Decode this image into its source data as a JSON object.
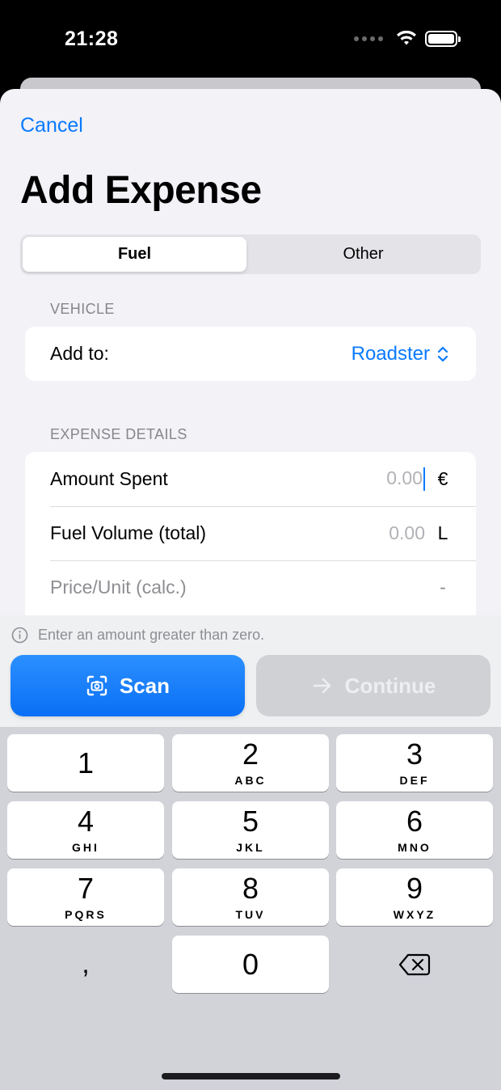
{
  "status_bar": {
    "time": "21:28"
  },
  "nav": {
    "cancel_label": "Cancel",
    "title": "Add Expense"
  },
  "segments": {
    "fuel": "Fuel",
    "other": "Other",
    "selected": "Fuel"
  },
  "vehicle_section": {
    "header": "VEHICLE",
    "add_to_label": "Add to:",
    "vehicle_value": "Roadster"
  },
  "details_section": {
    "header": "EXPENSE DETAILS",
    "amount_label": "Amount Spent",
    "amount_placeholder": "0.00",
    "amount_unit": "€",
    "volume_label": "Fuel Volume (total)",
    "volume_placeholder": "0.00",
    "volume_unit": "L",
    "price_label": "Price/Unit (calc.)",
    "price_value": "-"
  },
  "accessory": {
    "hint": "Enter an amount greater than zero.",
    "scan_label": "Scan",
    "continue_label": "Continue",
    "continue_enabled": false
  },
  "keyboard": {
    "keys": [
      {
        "num": "1",
        "letters": ""
      },
      {
        "num": "2",
        "letters": "ABC"
      },
      {
        "num": "3",
        "letters": "DEF"
      },
      {
        "num": "4",
        "letters": "GHI"
      },
      {
        "num": "5",
        "letters": "JKL"
      },
      {
        "num": "6",
        "letters": "MNO"
      },
      {
        "num": "7",
        "letters": "PQRS"
      },
      {
        "num": "8",
        "letters": "TUV"
      },
      {
        "num": "9",
        "letters": "WXYZ"
      }
    ],
    "decimal": ",",
    "zero": "0",
    "delete_icon": "delete-backward-icon"
  },
  "colors": {
    "accent": "#0a7aff",
    "background": "#f2f2f7",
    "keyboard": "#d1d3d9",
    "disabled_button": "#d0d1d4"
  }
}
